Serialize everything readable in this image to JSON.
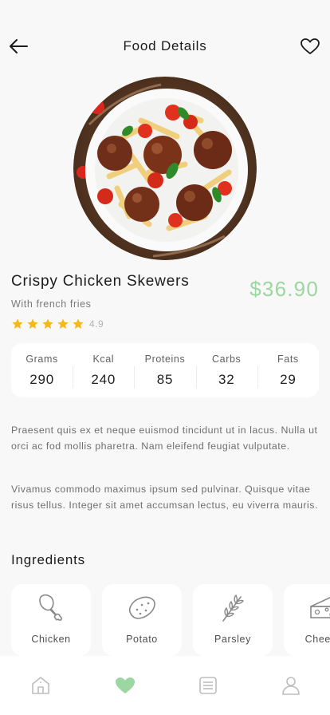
{
  "header": {
    "title": "Food Details"
  },
  "dish": {
    "name": "Crispy Chicken Skewers",
    "subtitle": "With french fries",
    "price": "$36.90",
    "rating_stars": 5,
    "rating_value": "4.9"
  },
  "nutrition": [
    {
      "label": "Grams",
      "value": "290"
    },
    {
      "label": "Kcal",
      "value": "240"
    },
    {
      "label": "Proteins",
      "value": "85"
    },
    {
      "label": "Carbs",
      "value": "32"
    },
    {
      "label": "Fats",
      "value": "29"
    }
  ],
  "description": [
    "Praesent quis ex et neque euismod tincidunt ut in lacus. Nulla ut orci ac fod mollis pharetra. Nam eleifend feugiat vulputate.",
    "Vivamus commodo maximus ipsum sed pulvinar. Quisque vitae risus tellus. Integer sit amet accumsan lectus, eu viverra mauris."
  ],
  "ingredients": {
    "title": "Ingredients",
    "items": [
      {
        "label": "Chicken",
        "icon": "chicken-leg-icon"
      },
      {
        "label": "Potato",
        "icon": "potato-icon"
      },
      {
        "label": "Parsley",
        "icon": "parsley-icon"
      },
      {
        "label": "Cheese",
        "icon": "cheese-icon"
      }
    ]
  },
  "bottom_nav": [
    {
      "icon": "home-icon",
      "active": false
    },
    {
      "icon": "heart-icon",
      "active": true
    },
    {
      "icon": "list-icon",
      "active": false
    },
    {
      "icon": "profile-icon",
      "active": false
    }
  ],
  "colors": {
    "accent": "#9cd6a0",
    "star": "#f4b81d",
    "card": "#ffffff",
    "background": "#f8f8f8"
  }
}
